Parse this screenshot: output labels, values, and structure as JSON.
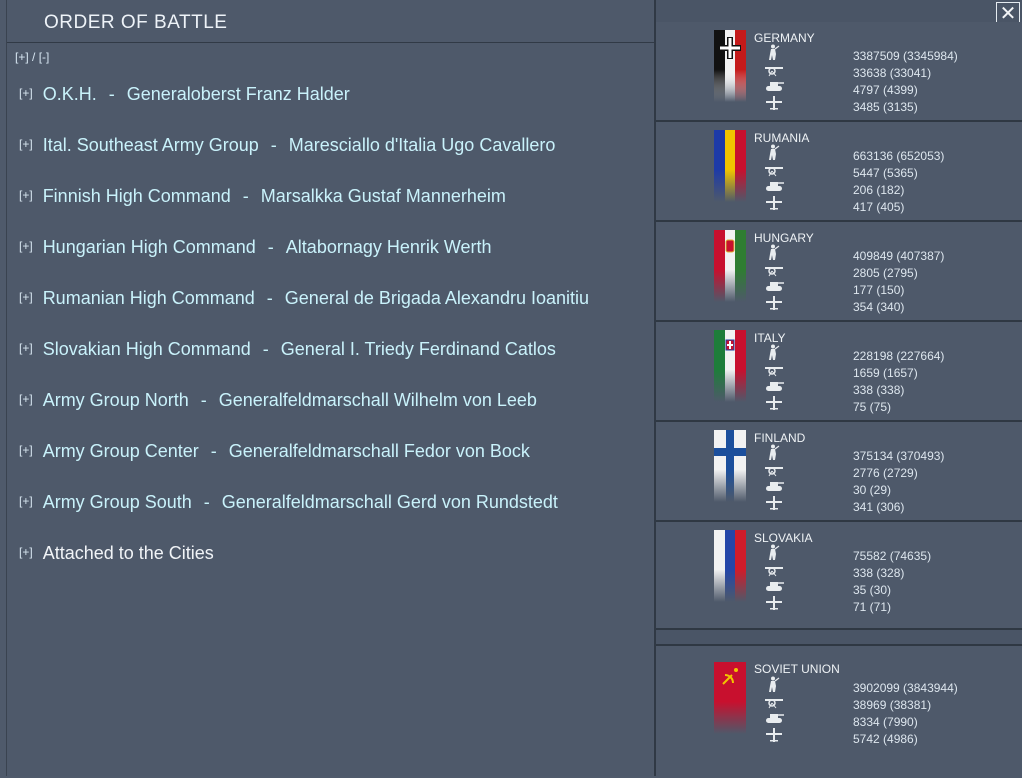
{
  "header": {
    "title": "ORDER OF BATTLE",
    "expand": "[+]",
    "slash": "/",
    "collapse": "[-]"
  },
  "toggle_label": "[+]",
  "oob": [
    {
      "unit": "O.K.H.",
      "commander": "Generaloberst Franz Halder"
    },
    {
      "unit": "Ital. Southeast Army Group",
      "commander": "Maresciallo d'Italia Ugo Cavallero"
    },
    {
      "unit": "Finnish High Command",
      "commander": "Marsalkka Gustaf Mannerheim"
    },
    {
      "unit": "Hungarian High Command",
      "commander": "Altabornagy Henrik Werth"
    },
    {
      "unit": "Rumanian High Command",
      "commander": "General de Brigada Alexandru Ioanitiu"
    },
    {
      "unit": "Slovakian High Command",
      "commander": "General I. Triedy Ferdinand Catlos"
    },
    {
      "unit": "Army Group North",
      "commander": "Generalfeldmarschall Wilhelm von Leeb"
    },
    {
      "unit": "Army Group Center",
      "commander": "Generalfeldmarschall Fedor von Bock"
    },
    {
      "unit": "Army Group South",
      "commander": "Generalfeldmarschall Gerd von Rundstedt"
    },
    {
      "unit": "Attached to the Cities",
      "commander": ""
    }
  ],
  "separator": "-",
  "nations": [
    {
      "name": "GERMANY",
      "flag": "germany",
      "men": "3387509 (3345984)",
      "guns": "33638 (33041)",
      "tanks": "4797 (4399)",
      "aircraft": "3485 (3135)"
    },
    {
      "name": "RUMANIA",
      "flag": "rumania",
      "men": "663136 (652053)",
      "guns": "5447 (5365)",
      "tanks": "206 (182)",
      "aircraft": "417 (405)"
    },
    {
      "name": "HUNGARY",
      "flag": "hungary",
      "men": "409849 (407387)",
      "guns": "2805 (2795)",
      "tanks": "177 (150)",
      "aircraft": "354 (340)"
    },
    {
      "name": "ITALY",
      "flag": "italy",
      "men": "228198 (227664)",
      "guns": "1659 (1657)",
      "tanks": "338 (338)",
      "aircraft": "75 (75)"
    },
    {
      "name": "FINLAND",
      "flag": "finland",
      "men": "375134 (370493)",
      "guns": "2776 (2729)",
      "tanks": "30 (29)",
      "aircraft": "341 (306)"
    },
    {
      "name": "SLOVAKIA",
      "flag": "slovakia",
      "men": "75582 (74635)",
      "guns": "338 (328)",
      "tanks": "35 (30)",
      "aircraft": "71 (71)"
    },
    {
      "name": "SOVIET UNION",
      "flag": "soviet",
      "men": "3902099 (3843944)",
      "guns": "38969 (38381)",
      "tanks": "8334 (7990)",
      "aircraft": "5742 (4986)"
    }
  ],
  "icons": [
    "infantry-icon",
    "artillery-icon",
    "tank-icon",
    "aircraft-icon"
  ],
  "colors": {
    "unit_text": "#c9f2fb",
    "panel_bg": "#4e596a"
  }
}
